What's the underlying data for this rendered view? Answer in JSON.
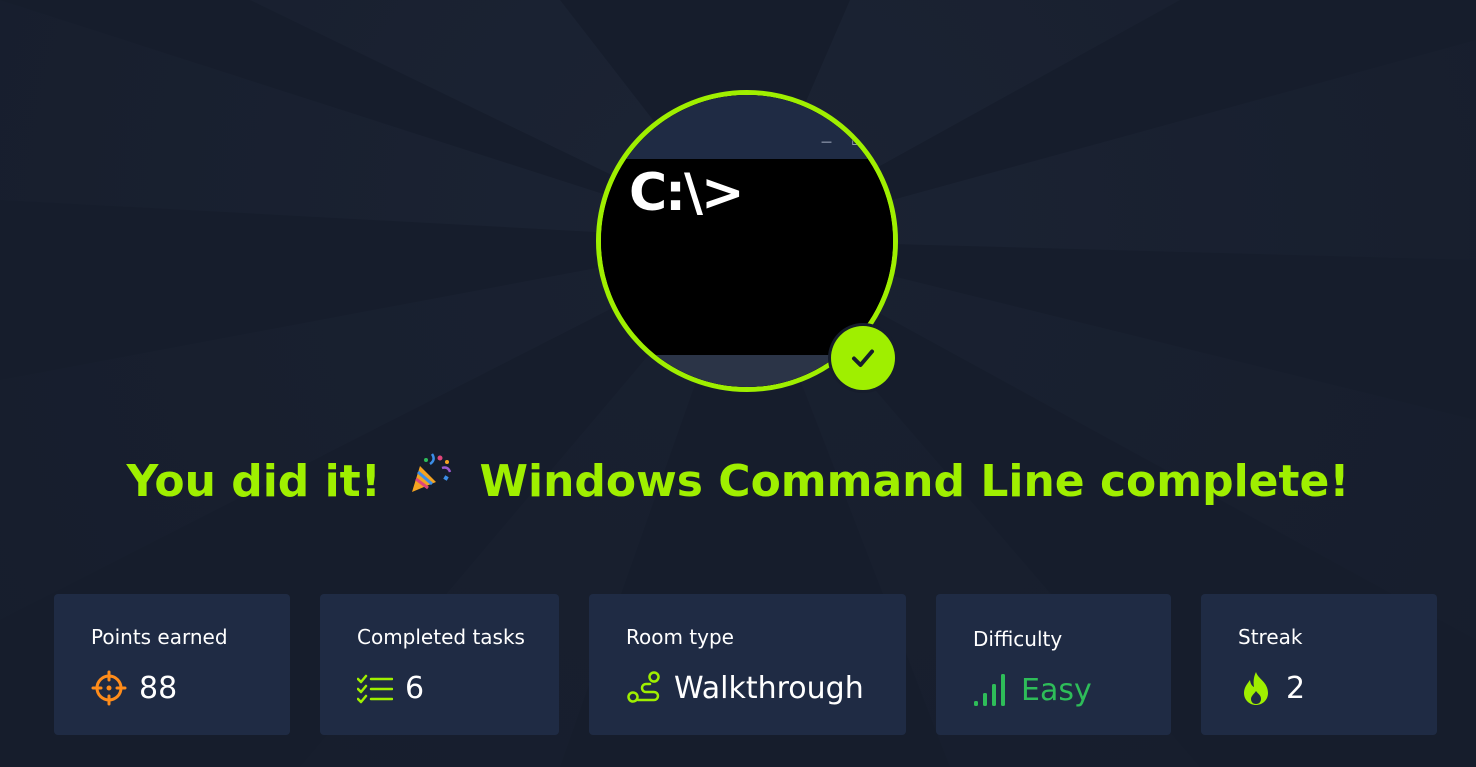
{
  "badge": {
    "prompt_text": "C:\\>",
    "titlebar_controls": "— ☐",
    "status": "completed"
  },
  "headline": {
    "prefix": "You did it!",
    "emoji": "party-popper",
    "room_name": "Windows Command Line",
    "suffix": "complete!"
  },
  "stats": [
    {
      "label": "Points earned",
      "value": "88",
      "icon": "target-icon"
    },
    {
      "label": "Completed tasks",
      "value": "6",
      "icon": "checklist-icon"
    },
    {
      "label": "Room type",
      "value": "Walkthrough",
      "icon": "route-icon"
    },
    {
      "label": "Difficulty",
      "value": "Easy",
      "icon": "signal-bars-icon"
    },
    {
      "label": "Streak",
      "value": "2",
      "icon": "flame-icon"
    }
  ],
  "colors": {
    "background": "#161d2c",
    "card": "#1f2b44",
    "accent": "#9fef00",
    "points_icon": "#ff8c1a",
    "easy_green": "#2ebd59"
  }
}
